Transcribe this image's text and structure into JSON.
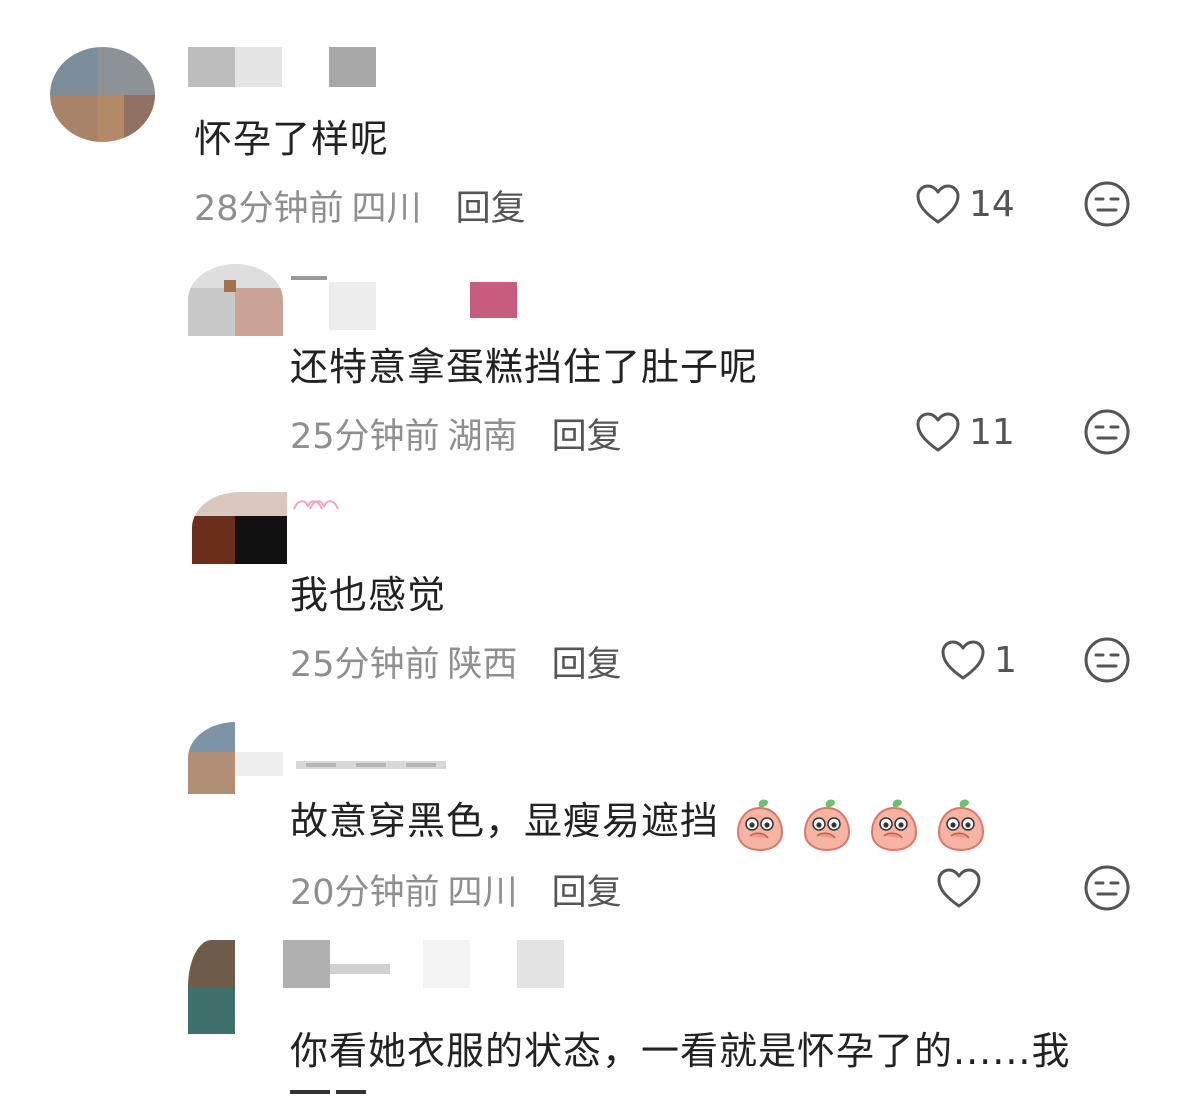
{
  "comments": [
    {
      "text": "怀孕了样呢",
      "time": "28分钟前",
      "location": "四川",
      "reply_label": "回复",
      "likes": "14"
    },
    {
      "text": "还特意拿蛋糕挡住了肚子呢",
      "time": "25分钟前",
      "location": "湖南",
      "reply_label": "回复",
      "likes": "11"
    },
    {
      "text": "我也感觉",
      "time": "25分钟前",
      "location": "陕西",
      "reply_label": "回复",
      "likes": "1"
    },
    {
      "text": "故意穿黑色，显瘦易遮挡",
      "time": "20分钟前",
      "location": "四川",
      "reply_label": "回复",
      "likes": ""
    },
    {
      "text": "你看她衣服的状态，一看就是怀孕了的......我"
    }
  ],
  "icons": {
    "like": "heart-outline-icon",
    "dislike": "meh-face-icon",
    "emoji": "peach-covering-mouth-emoji"
  },
  "colors": {
    "text": "#222222",
    "meta": "#8f8f8f",
    "icon": "#555555",
    "masked_tag": "#c75c7f"
  }
}
